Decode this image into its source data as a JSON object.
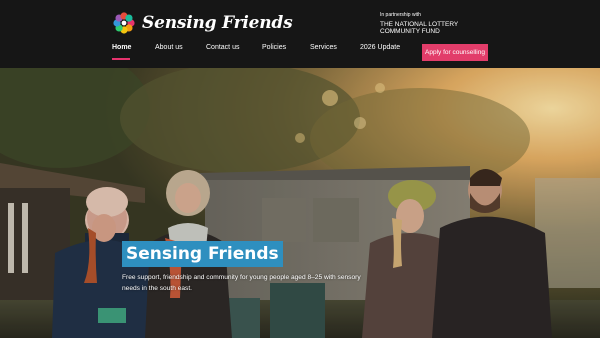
{
  "brand": {
    "name": "Sensing Friends",
    "logo_icon": "flower-logo-icon",
    "logo_colors": [
      "#e6336d",
      "#f39c12",
      "#f1c40f",
      "#2ecc71",
      "#3498db",
      "#9b59b6",
      "#e74c3c",
      "#1abc9c"
    ]
  },
  "partner": {
    "tagline": "In partnership with",
    "name": "THE NATIONAL LOTTERY COMMUNITY FUND"
  },
  "nav": {
    "items": [
      {
        "label": "Home",
        "active": true
      },
      {
        "label": "About us"
      },
      {
        "label": "Contact us"
      },
      {
        "label": "Policies"
      },
      {
        "label": "Services"
      },
      {
        "label": "2026 Update"
      }
    ],
    "cta": "Apply for counselling",
    "accent": "#e23d6a"
  },
  "hero": {
    "title": "Sensing Friends",
    "subtitle": "Free support, friendship and community for young people aged 8–25 with sensory needs in the south east.",
    "title_bg": "#2e8fbf"
  }
}
